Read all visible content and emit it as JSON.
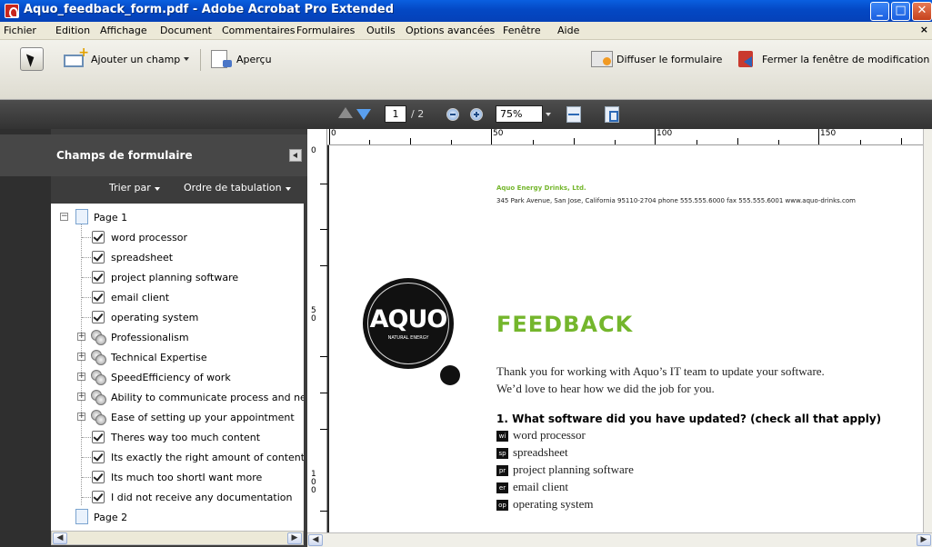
{
  "window": {
    "title": "Aquo_feedback_form.pdf - Adobe Acrobat Pro Extended"
  },
  "menu": [
    "Fichier",
    "Edition",
    "Affichage",
    "Document",
    "Commentaires",
    "Formulaires",
    "Outils",
    "Options avancées",
    "Fenêtre",
    "Aide"
  ],
  "toolbar": {
    "add_field": "Ajouter un champ",
    "preview": "Aperçu",
    "distribute": "Diffuser le formulaire",
    "close_edit": "Fermer la fenêtre de modification"
  },
  "nav": {
    "page_current": "1",
    "page_total": "/ 2",
    "zoom": "75%"
  },
  "panel": {
    "title": "Champs de formulaire",
    "sort_by": "Trier par",
    "tab_order": "Ordre de tabulation",
    "tree": [
      "Page 1",
      "word processor",
      "spreadsheet",
      "project planning software",
      "email client",
      "operating system",
      "Professionalism",
      "Technical Expertise",
      "SpeedEfficiency of work",
      "Ability to communicate process and next",
      "Ease of setting up your appointment",
      "Theres way too much content",
      "Its exactly the right amount of content",
      "Its much too shortI want more",
      "I did not receive any documentation",
      "Page 2"
    ]
  },
  "ruler": {
    "h": [
      "0",
      "50",
      "100",
      "150"
    ],
    "v": [
      "0",
      "5 0",
      "1 0 0"
    ]
  },
  "document": {
    "company": "Aquo Energy Drinks, Ltd.",
    "address": "345 Park Avenue, San Jose, California 95110-2704   phone 555.555.6000  fax 555.555.6001  www.aquo-drinks.com",
    "logo_text": "AQUO",
    "logo_sub": "NATURAL ENERGY",
    "heading": "FEEDBACK",
    "intro_line1": "Thank you for working with Aquo’s IT team to update your software.",
    "intro_line2": "We’d love to hear how we did the job for you.",
    "question": "1. What software did you have updated? (check all that apply)",
    "options": [
      {
        "code": "wi",
        "label": "word processor"
      },
      {
        "code": "sp",
        "label": "spreadsheet"
      },
      {
        "code": "pr",
        "label": "project planning software"
      },
      {
        "code": "er",
        "label": "email client"
      },
      {
        "code": "op",
        "label": "operating system"
      }
    ]
  }
}
